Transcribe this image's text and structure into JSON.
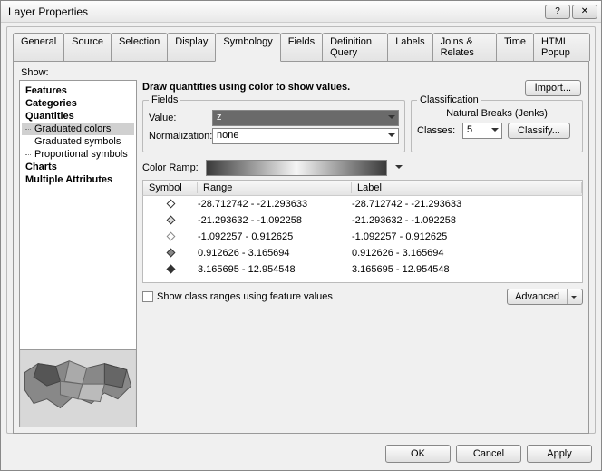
{
  "window": {
    "title": "Layer Properties"
  },
  "tabs": [
    "General",
    "Source",
    "Selection",
    "Display",
    "Symbology",
    "Fields",
    "Definition Query",
    "Labels",
    "Joins & Relates",
    "Time",
    "HTML Popup"
  ],
  "activeTab": "Symbology",
  "show_label": "Show:",
  "tree": {
    "features": "Features",
    "categories": "Categories",
    "quantities": "Quantities",
    "graduated_colors": "Graduated colors",
    "graduated_symbols": "Graduated symbols",
    "proportional_symbols": "Proportional symbols",
    "charts": "Charts",
    "multiple": "Multiple Attributes"
  },
  "heading": "Draw quantities using color to show values.",
  "import_btn": "Import...",
  "fields": {
    "legend": "Fields",
    "value_label": "Value:",
    "value": "z",
    "norm_label": "Normalization:",
    "norm": "none"
  },
  "classification": {
    "legend": "Classification",
    "method": "Natural Breaks (Jenks)",
    "classes_label": "Classes:",
    "classes": "5",
    "classify_btn": "Classify..."
  },
  "color_ramp_label": "Color Ramp:",
  "list_headers": {
    "symbol": "Symbol",
    "range": "Range",
    "label": "Label"
  },
  "rows": [
    {
      "range": "-28.712742 - -21.293633",
      "label": "-28.712742 - -21.293633"
    },
    {
      "range": "-21.293632 - -1.092258",
      "label": "-21.293632 - -1.092258"
    },
    {
      "range": "-1.092257 - 0.912625",
      "label": "-1.092257 - 0.912625"
    },
    {
      "range": "0.912626 - 3.165694",
      "label": "0.912626 - 3.165694"
    },
    {
      "range": "3.165695 - 12.954548",
      "label": "3.165695 - 12.954548"
    }
  ],
  "show_ranges": "Show class ranges using feature values",
  "advanced": "Advanced",
  "buttons": {
    "ok": "OK",
    "cancel": "Cancel",
    "apply": "Apply"
  }
}
